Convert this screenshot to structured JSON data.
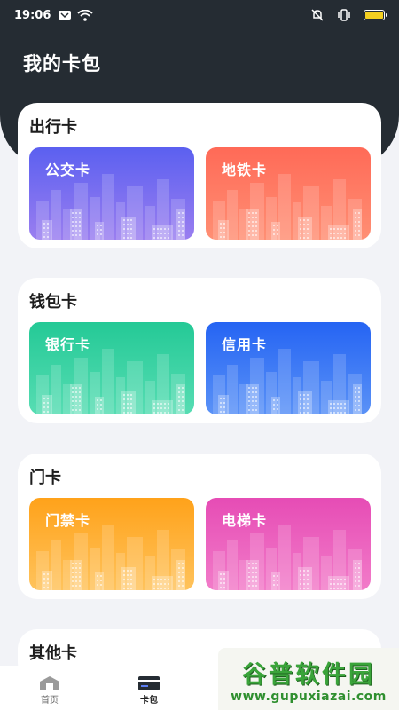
{
  "status_bar": {
    "time": "19:06",
    "icons": [
      "mail-icon",
      "wifi-icon",
      "mute-icon",
      "vibrate-icon",
      "battery-icon"
    ],
    "battery_color": "#f5d020"
  },
  "header": {
    "title": "我的卡包",
    "background": "#252c33"
  },
  "sections": [
    {
      "title": "出行卡",
      "cards": [
        {
          "label": "公交卡",
          "color": "#5b60f0"
        },
        {
          "label": "地铁卡",
          "color": "#ff6a57"
        }
      ]
    },
    {
      "title": "钱包卡",
      "cards": [
        {
          "label": "银行卡",
          "color": "#24c996"
        },
        {
          "label": "信用卡",
          "color": "#2564f3"
        }
      ]
    },
    {
      "title": "门卡",
      "cards": [
        {
          "label": "门禁卡",
          "color": "#ffa21a"
        },
        {
          "label": "电梯卡",
          "color": "#e64cb5"
        }
      ]
    },
    {
      "title": "其他卡",
      "cards": []
    }
  ],
  "bottom_nav": {
    "items": [
      {
        "label": "首页",
        "icon": "home-icon",
        "active": false
      },
      {
        "label": "卡包",
        "icon": "card-icon",
        "active": true
      }
    ]
  },
  "watermark": {
    "main": "谷普软件园",
    "sub": "www.gupuxiazai.com"
  }
}
